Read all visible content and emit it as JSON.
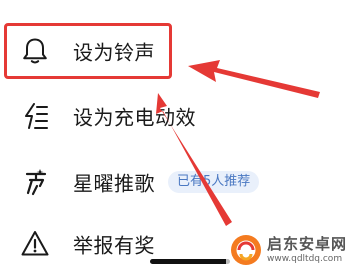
{
  "menu": {
    "items": [
      {
        "label": "设为铃声",
        "icon": "bell-icon"
      },
      {
        "label": "设为充电动效",
        "icon": "charging-effect-icon"
      },
      {
        "label": "星曜推歌",
        "icon": "star-recommend-icon",
        "badge": "已有5人推荐"
      },
      {
        "label": "举报有奖",
        "icon": "report-alert-icon"
      }
    ]
  },
  "annotation": {
    "box_color": "#e53935",
    "arrow_color": "#e53935"
  },
  "colors": {
    "badge_background": "#e9f0fb",
    "badge_text": "#4a78c2",
    "text": "#1a1a1a"
  },
  "watermark": {
    "title": "启东安卓网",
    "url": "www.qdltdq.com"
  }
}
